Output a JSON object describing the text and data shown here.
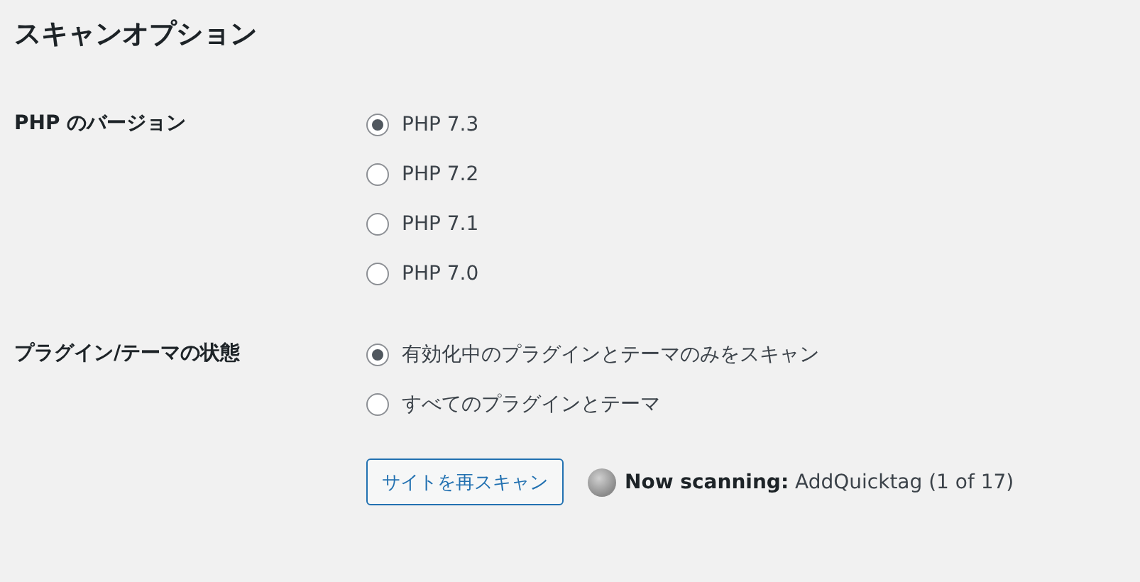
{
  "heading": "スキャンオプション",
  "settings": [
    {
      "label": "PHP のバージョン",
      "options": [
        {
          "label": "PHP 7.3",
          "selected": true
        },
        {
          "label": "PHP 7.2",
          "selected": false
        },
        {
          "label": "PHP 7.1",
          "selected": false
        },
        {
          "label": "PHP 7.0",
          "selected": false
        }
      ]
    },
    {
      "label": "プラグイン/テーマの状態",
      "options": [
        {
          "label": "有効化中のプラグインとテーマのみをスキャン",
          "selected": true
        },
        {
          "label": "すべてのプラグインとテーマ",
          "selected": false
        }
      ]
    }
  ],
  "rescan_button": "サイトを再スキャン",
  "status": "**Now scanning:** AddQuicktag (1 of 17)"
}
